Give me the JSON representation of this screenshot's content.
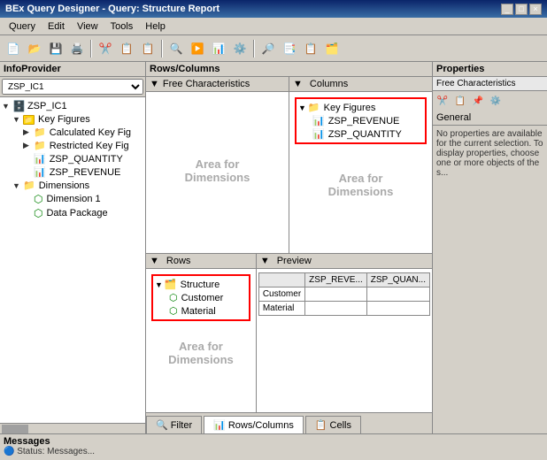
{
  "titleBar": {
    "text": "BEx Query Designer - Query: Structure Report",
    "buttons": [
      "_",
      "□",
      "×"
    ]
  },
  "menuBar": {
    "items": [
      "Query",
      "Edit",
      "View",
      "Tools",
      "Help"
    ]
  },
  "toolbar": {
    "buttons": [
      "📄",
      "📁",
      "💾",
      "🖨️",
      "✂️",
      "📋",
      "📋",
      "↩️",
      "⚙️",
      "🔍",
      "▶️",
      "📊",
      "🔧"
    ]
  },
  "infoProvider": {
    "header": "InfoProvider",
    "selectValue": "ZSP_IC1",
    "tree": [
      {
        "label": "ZSP_IC1",
        "level": 0,
        "type": "root",
        "expanded": true
      },
      {
        "label": "Key Figures",
        "level": 1,
        "type": "folder",
        "expanded": true
      },
      {
        "label": "Calculated Key Fig",
        "level": 2,
        "type": "folder"
      },
      {
        "label": "Restricted Key Fig",
        "level": 2,
        "type": "folder"
      },
      {
        "label": "ZSP_QUANTITY",
        "level": 2,
        "type": "keyfig"
      },
      {
        "label": "ZSP_REVENUE",
        "level": 2,
        "type": "keyfig"
      },
      {
        "label": "Dimensions",
        "level": 1,
        "type": "folder",
        "expanded": true
      },
      {
        "label": "Dimension 1",
        "level": 2,
        "type": "dim"
      },
      {
        "label": "Data Package",
        "level": 2,
        "type": "dim"
      }
    ]
  },
  "rowsColumns": {
    "header": "Rows/Columns"
  },
  "freeCharacteristics": {
    "header": "Free Characteristics",
    "watermark": "Area for\nDimensions"
  },
  "columns": {
    "header": "Columns",
    "items": [
      {
        "label": "Key Figures",
        "level": 0,
        "type": "folder",
        "expanded": true
      },
      {
        "label": "ZSP_REVENUE",
        "level": 1,
        "type": "keyfig"
      },
      {
        "label": "ZSP_QUANTITY",
        "level": 1,
        "type": "keyfig"
      }
    ],
    "watermark": "Area for\nDimensions"
  },
  "rows": {
    "header": "Rows",
    "items": [
      {
        "label": "Structure",
        "level": 0,
        "type": "struct",
        "expanded": true
      },
      {
        "label": "Customer",
        "level": 1,
        "type": "dim"
      },
      {
        "label": "Material",
        "level": 1,
        "type": "dim"
      }
    ],
    "watermark": "Area for\nDimensions"
  },
  "preview": {
    "header": "Preview",
    "columns": [
      "ZSP_REVE...",
      "ZSP_QUAN..."
    ],
    "rows": [
      {
        "label": "Customer",
        "values": [
          "",
          ""
        ]
      },
      {
        "label": "Material",
        "values": [
          "",
          ""
        ]
      }
    ]
  },
  "properties": {
    "header": "Properties",
    "subHeader": "Free Characteristics",
    "tabs": [
      "General"
    ],
    "content": "No properties are available for the current selection. To display properties, choose one or more objects of the s..."
  },
  "tabs": [
    {
      "label": "Filter",
      "active": false
    },
    {
      "label": "Rows/Columns",
      "active": true
    },
    {
      "label": "Cells",
      "active": false
    }
  ],
  "messages": {
    "header": "Messages",
    "status": "Status: Messages..."
  },
  "icons": {
    "filter": "🔍",
    "rowscols": "📊",
    "cells": "📋"
  }
}
